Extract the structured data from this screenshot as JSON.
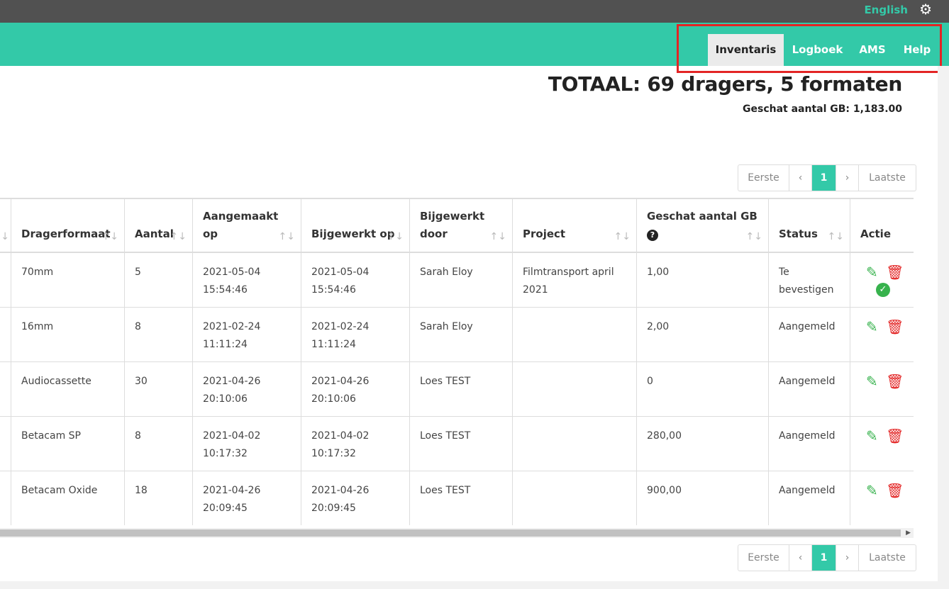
{
  "topbar": {
    "language": "English",
    "settings_icon": "gear-icon"
  },
  "nav": {
    "items": [
      {
        "label": "Inventaris",
        "active": true
      },
      {
        "label": "Logboek",
        "active": false
      },
      {
        "label": "AMS",
        "active": false
      },
      {
        "label": "Help",
        "active": false
      }
    ]
  },
  "summary": {
    "total": "TOTAAL: 69 dragers, 5 formaten",
    "gb": "Geschat aantal GB: 1,183.00"
  },
  "pagination": {
    "first": "Eerste",
    "prev": "‹",
    "page": "1",
    "next": "›",
    "last": "Laatste"
  },
  "table": {
    "columns": [
      {
        "label": ""
      },
      {
        "label": "Dragerformaat"
      },
      {
        "label": "Aantal"
      },
      {
        "label": "Aangemaakt op"
      },
      {
        "label": "Bijgewerkt op"
      },
      {
        "label": "Bijgewerkt door"
      },
      {
        "label": "Project"
      },
      {
        "label": "Geschat aantal GB"
      },
      {
        "label": "Status"
      },
      {
        "label": "Actie"
      }
    ],
    "sort_icon": "↑↓",
    "help_icon": "?",
    "rows": [
      {
        "format": "70mm",
        "count": "5",
        "created_date": "2021-05-04",
        "created_time": "15:54:46",
        "updated_date": "2021-05-04",
        "updated_time": "15:54:46",
        "updated_by": "Sarah Eloy",
        "project": "Filmtransport april 2021",
        "gb": "1,00",
        "status": "Te bevestigen",
        "confirmable": true
      },
      {
        "format": "16mm",
        "count": "8",
        "created_date": "2021-02-24",
        "created_time": "11:11:24",
        "updated_date": "2021-02-24",
        "updated_time": "11:11:24",
        "updated_by": "Sarah Eloy",
        "project": "",
        "gb": "2,00",
        "status": "Aangemeld",
        "confirmable": false
      },
      {
        "format": "Audiocassette",
        "count": "30",
        "created_date": "2021-04-26",
        "created_time": "20:10:06",
        "updated_date": "2021-04-26",
        "updated_time": "20:10:06",
        "updated_by": "Loes TEST",
        "project": "",
        "gb": "0",
        "status": "Aangemeld",
        "confirmable": false
      },
      {
        "format": "Betacam SP",
        "count": "8",
        "created_date": "2021-04-02",
        "created_time": "10:17:32",
        "updated_date": "2021-04-02",
        "updated_time": "10:17:32",
        "updated_by": "Loes TEST",
        "project": "",
        "gb": "280,00",
        "status": "Aangemeld",
        "confirmable": false
      },
      {
        "format": "Betacam Oxide",
        "count": "18",
        "created_date": "2021-04-26",
        "created_time": "20:09:45",
        "updated_date": "2021-04-26",
        "updated_time": "20:09:45",
        "updated_by": "Loes TEST",
        "project": "",
        "gb": "900,00",
        "status": "Aangemeld",
        "confirmable": false
      }
    ]
  },
  "colors": {
    "accent": "#33c9a8",
    "topbar": "#515151",
    "edit": "#37b24d",
    "delete": "#e32525"
  }
}
